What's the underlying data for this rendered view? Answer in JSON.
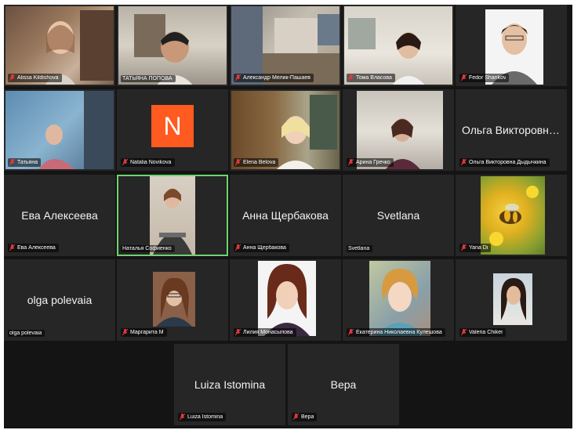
{
  "participants": [
    {
      "name": "Alissa Kildishova",
      "display": "video",
      "muted": true
    },
    {
      "name": "ТАТЬЯНА ПОПОВА",
      "display": "video",
      "muted": false
    },
    {
      "name": "Александр Мелик-Пашаев",
      "display": "video",
      "muted": true
    },
    {
      "name": "Тома Власова",
      "display": "video",
      "muted": true
    },
    {
      "name": "Fedor Shankov",
      "display": "photo",
      "muted": true
    },
    {
      "name": "Татьяна",
      "display": "video",
      "muted": true
    },
    {
      "name": "Natalia Novikova",
      "display": "avatar",
      "avatar_letter": "N",
      "muted": true
    },
    {
      "name": "Elena Belova",
      "display": "video",
      "muted": true
    },
    {
      "name": "Арина Гречко",
      "display": "video",
      "muted": true
    },
    {
      "name": "Ольга Викторовна Дыдычкина",
      "display": "name",
      "big_name": "Ольга Викторовна Дыд...",
      "muted": true
    },
    {
      "name": "Ева Алексеева",
      "display": "name",
      "big_name": "Ева Алексеева",
      "muted": true
    },
    {
      "name": "Наталья Софиенко",
      "display": "video",
      "muted": false,
      "active_speaker": true
    },
    {
      "name": "Анна Щербакова",
      "display": "name",
      "big_name": "Анна Щербакова",
      "muted": true
    },
    {
      "name": "Svetlana",
      "display": "name",
      "big_name": "Svetlana",
      "muted": false
    },
    {
      "name": "Yana Di",
      "display": "photo",
      "muted": true
    },
    {
      "name": "olga polevaia",
      "display": "name",
      "big_name": "olga polevaia",
      "muted": false
    },
    {
      "name": "Маргарита М",
      "display": "photo",
      "muted": true
    },
    {
      "name": "Лилия Монасыпова",
      "display": "photo",
      "muted": true
    },
    {
      "name": "Екатерина Николаевна Кулешова",
      "display": "photo",
      "muted": true
    },
    {
      "name": "Valeria Chiker",
      "display": "photo",
      "muted": true
    },
    {
      "name": "Luiza Istomina",
      "display": "name",
      "big_name": "Luiza Istomina",
      "muted": true
    },
    {
      "name": "Вера",
      "display": "name",
      "big_name": "Вера",
      "muted": true
    }
  ],
  "colors": {
    "background": "#141414",
    "tile": "#262626",
    "active_speaker_border": "#6fd36f",
    "muted_mic": "#e5383b",
    "avatar": "#ff5a1f"
  }
}
